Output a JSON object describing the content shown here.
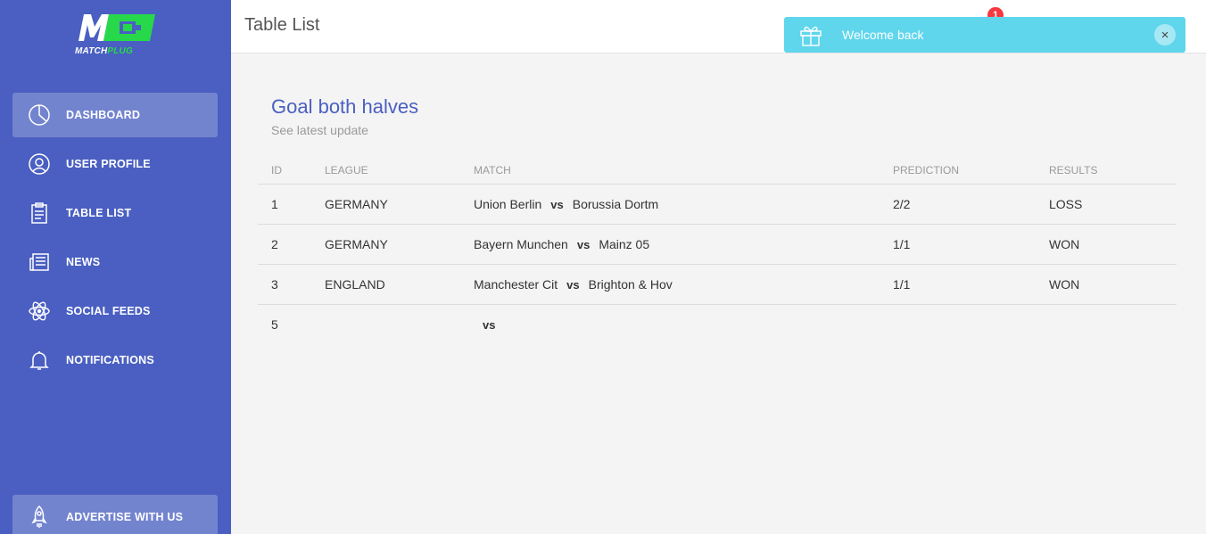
{
  "brand": {
    "logo_text_1": "MATCH",
    "logo_text_2": "PLUG",
    "accent": "#4a5fc1",
    "green": "#27d94a"
  },
  "sidebar": {
    "items": [
      {
        "label": "DASHBOARD",
        "icon": "pie-chart-icon",
        "active": true
      },
      {
        "label": "USER PROFILE",
        "icon": "user-icon",
        "active": false
      },
      {
        "label": "TABLE LIST",
        "icon": "clipboard-icon",
        "active": false
      },
      {
        "label": "NEWS",
        "icon": "newspaper-icon",
        "active": false
      },
      {
        "label": "SOCIAL FEEDS",
        "icon": "atom-icon",
        "active": false
      },
      {
        "label": "NOTIFICATIONS",
        "icon": "bell-icon",
        "active": false
      }
    ],
    "bottom": {
      "label": "ADVERTISE WITH US",
      "icon": "rocket-icon"
    }
  },
  "header": {
    "title": "Table List",
    "notification_count": "1"
  },
  "toast": {
    "message": "Welcome back",
    "close": "×",
    "color": "#5fd6ec"
  },
  "card": {
    "title": "Goal both halves",
    "subtitle": "See latest update"
  },
  "table": {
    "headers": [
      "ID",
      "LEAGUE",
      "MATCH",
      "PREDICTION",
      "RESULTS"
    ],
    "rows": [
      {
        "id": "1",
        "league": "GERMANY",
        "home": "Union Berlin",
        "vs": "vs",
        "away": "Borussia Dortm",
        "prediction": "2/2",
        "result": "LOSS"
      },
      {
        "id": "2",
        "league": "GERMANY",
        "home": "Bayern Munchen",
        "vs": "vs",
        "away": "Mainz 05",
        "prediction": "1/1",
        "result": "WON"
      },
      {
        "id": "3",
        "league": "ENGLAND",
        "home": "Manchester Cit",
        "vs": "vs",
        "away": "Brighton & Hov",
        "prediction": "1/1",
        "result": "WON"
      },
      {
        "id": "5",
        "league": "",
        "home": "",
        "vs": "vs",
        "away": "",
        "prediction": "",
        "result": ""
      }
    ]
  }
}
